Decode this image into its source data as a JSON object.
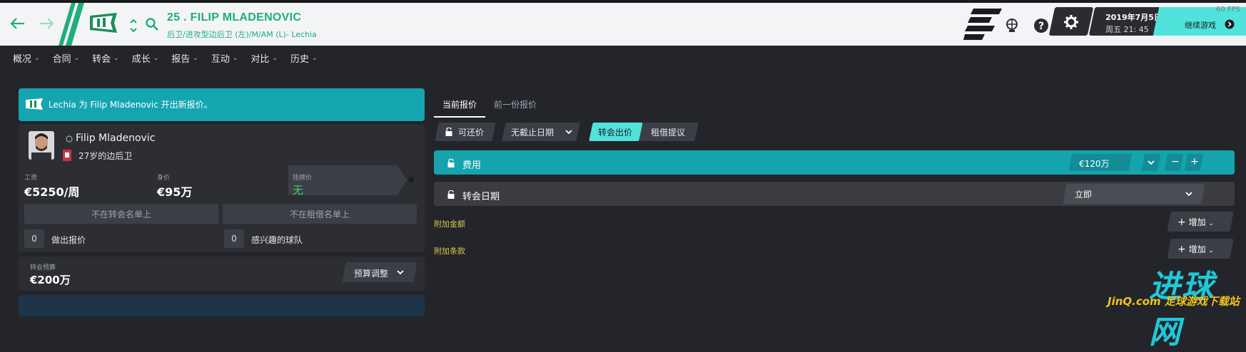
{
  "header": {
    "player_title": "25 . FILIP MLADENOVIC",
    "player_subtitle": "后卫/进攻型边后卫 (左)/M/AM (L)- Lechia",
    "date_line1": "2019年7月5日",
    "date_line2": "周五 21: 45",
    "continue_label": "继续游戏",
    "fps": "60 FPS"
  },
  "menu": {
    "items": [
      "概况",
      "合同",
      "转会",
      "成长",
      "报告",
      "互动",
      "对比",
      "历史"
    ]
  },
  "notice": {
    "text": "Lechia 为 Filip Mladenovic 开出新报价。"
  },
  "player_card": {
    "name": "Filip Mladenovic",
    "age_position": "27岁的边后卫",
    "wage_label": "工资",
    "wage_value": "€5250/周",
    "value_label": "身价",
    "value_value": "€95万",
    "asking_label": "挂牌价",
    "asking_value": "无",
    "transfer_list_status": "不在转会名单上",
    "loan_list_status": "不在租借名单上",
    "offers_count": "0",
    "offers_label": "做出报价",
    "interested_count": "0",
    "interested_label": "感兴趣的球队"
  },
  "budget": {
    "label": "转会预算",
    "value": "€200万",
    "adjust_label": "预算调整"
  },
  "offer": {
    "tabs": [
      "当前报价",
      "前一份报价"
    ],
    "negotiable_label": "可还价",
    "deadline_label": "无截止日期",
    "transfer_offer_label": "转会出价",
    "loan_offer_label": "租借提议",
    "fee_label": "费用",
    "fee_value": "€120万",
    "date_label": "转会日期",
    "date_value": "立即",
    "extra_amount_label": "附加金额",
    "extra_terms_label": "附加条款",
    "add_label": "增加"
  },
  "watermark": {
    "line1": "进球网",
    "line2": "JinQ.com 足球游戏下载站"
  },
  "colors": {
    "accent_green": "#1fae7c",
    "teal": "#15a3ae",
    "cyan": "#52e2dc",
    "yellow_label": "#d6c94a"
  }
}
